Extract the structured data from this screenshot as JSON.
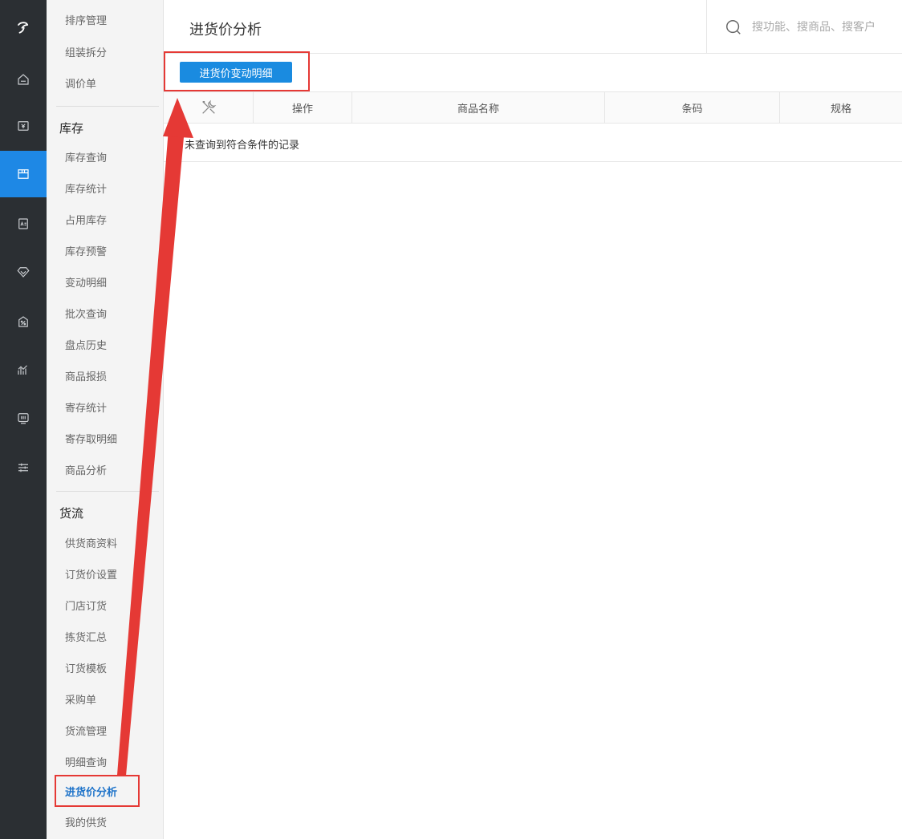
{
  "rail": {
    "items": [
      {
        "icon": "logo-icon"
      },
      {
        "icon": "home-icon"
      },
      {
        "icon": "money-icon"
      },
      {
        "icon": "inventory-icon",
        "active": true
      },
      {
        "icon": "member-card-icon"
      },
      {
        "icon": "diamond-icon"
      },
      {
        "icon": "promotion-icon"
      },
      {
        "icon": "report-chart-icon"
      },
      {
        "icon": "device-icon"
      },
      {
        "icon": "settings-sliders-icon"
      }
    ]
  },
  "submenu": {
    "top_items": [
      "排序管理",
      "组装拆分",
      "调价单"
    ],
    "inventory": {
      "heading": "库存",
      "items": [
        "库存查询",
        "库存统计",
        "占用库存",
        "库存预警",
        "变动明细",
        "批次查询",
        "盘点历史",
        "商品报损",
        "寄存统计",
        "寄存取明细",
        "商品分析"
      ]
    },
    "logistics": {
      "heading": "货流",
      "items": [
        "供货商资料",
        "订货价设置",
        "门店订货",
        "拣货汇总",
        "订货模板",
        "采购单",
        "货流管理",
        "明细查询",
        "进货价分析",
        "我的供货"
      ]
    }
  },
  "header": {
    "title": "进货价分析",
    "search_placeholder": "搜功能、搜商品、搜客户"
  },
  "toolbar": {
    "price_change_detail": "进货价变动明细"
  },
  "table": {
    "columns": [
      "操作",
      "商品名称",
      "条码",
      "规格"
    ],
    "empty_message": "未查询到符合条件的记录"
  },
  "colors": {
    "accent": "#1a8be0",
    "annotation": "#e53935",
    "rail_bg": "#2b2f33"
  }
}
